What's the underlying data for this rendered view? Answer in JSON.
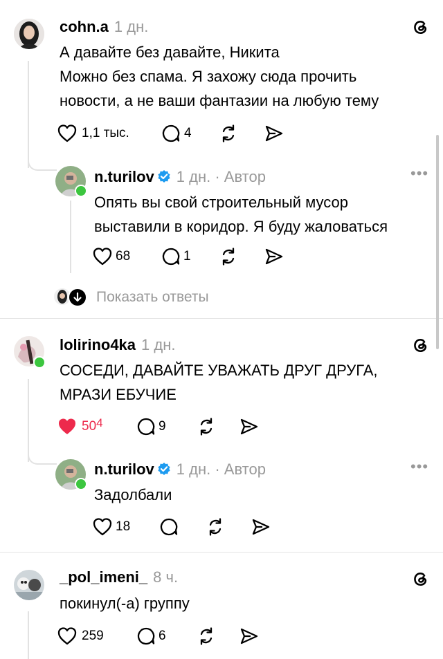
{
  "colors": {
    "like_active": "#ed2a4c",
    "verified": "#1d9bf0",
    "online": "#3cc63f",
    "muted": "#999999"
  },
  "posts": [
    {
      "username": "cohn.a",
      "time": "1 дн.",
      "text_lines": [
        "А давайте без давайте, Никита",
        "Можно без спама. Я захожу сюда прочить",
        "новости, а не ваши фантазии на любую тему"
      ],
      "likes": "1,1 тыс.",
      "comments": "4",
      "reply": {
        "username": "n.turilov",
        "time": "1 дн. · Автор",
        "text_lines": [
          "Опять вы свой строительный мусор",
          "выставили в коридор. Я буду жаловаться"
        ],
        "likes": "68",
        "comments": "1"
      },
      "show_replies": "Показать ответы"
    },
    {
      "username": "lolirino4ka",
      "time": "1 дн.",
      "text_lines": [
        "СОСЕДИ, ДАВАЙТЕ УВАЖАТЬ ДРУГ ДРУГА,",
        "МРАЗИ ЕБУЧИЕ"
      ],
      "likes": "50",
      "likes_delta": "4",
      "comments": "9",
      "reply": {
        "username": "n.turilov",
        "time": "1 дн. · Автор",
        "text_lines": [
          "Задолбали"
        ],
        "likes": "18",
        "comments": ""
      }
    },
    {
      "username": "_pol_imeni_",
      "time": "8 ч.",
      "text_lines": [
        "покинул(-а) группу"
      ],
      "likes": "259",
      "comments": "6"
    }
  ],
  "icons": {
    "threads": "threads-logo-icon",
    "like": "heart-icon",
    "comment": "comment-icon",
    "repost": "repost-icon",
    "share": "share-icon",
    "more": "more-icon"
  }
}
